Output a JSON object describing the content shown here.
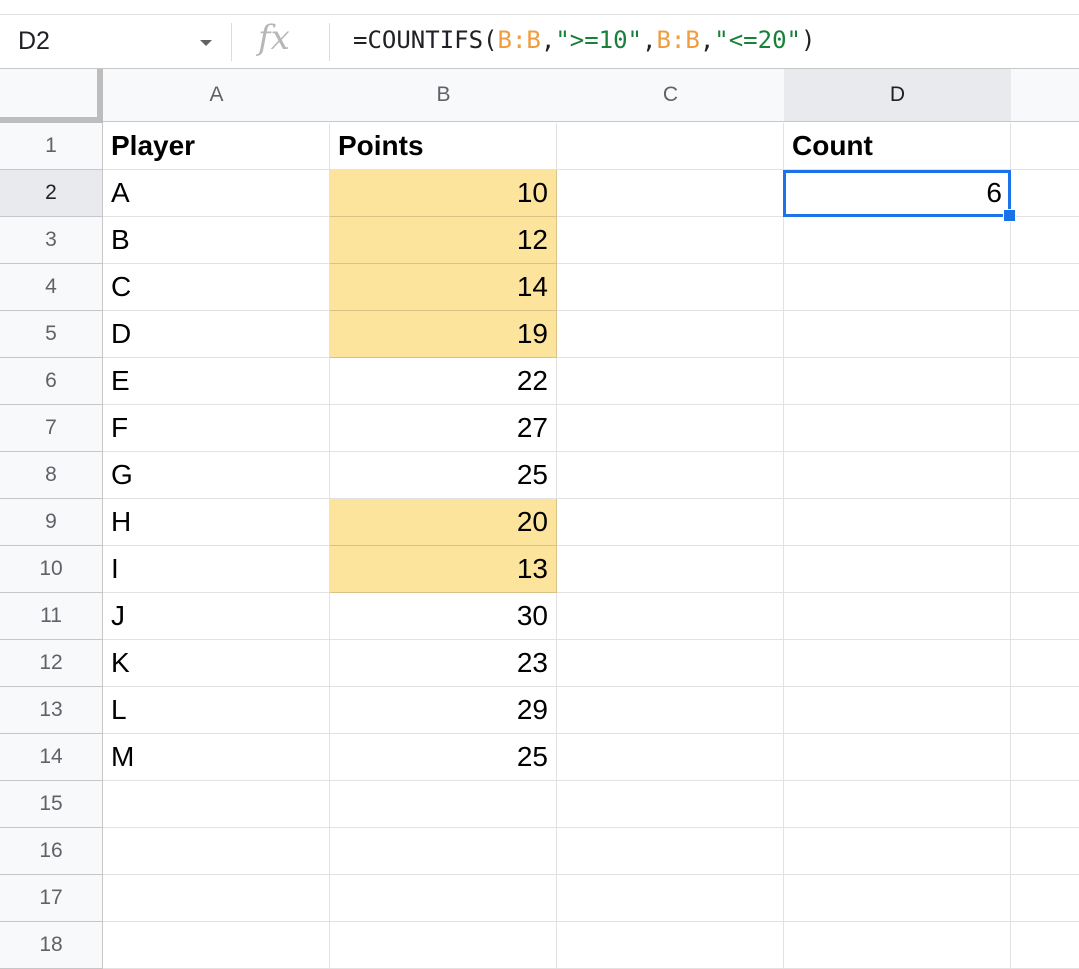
{
  "name_box": "D2",
  "fx_label": "fx",
  "formula": {
    "parts": [
      {
        "text": "=COUNTIFS(",
        "kind": "plain"
      },
      {
        "text": "B:B",
        "kind": "range"
      },
      {
        "text": ",",
        "kind": "plain"
      },
      {
        "text": "\">=10\"",
        "kind": "string"
      },
      {
        "text": ",",
        "kind": "plain"
      },
      {
        "text": "B:B",
        "kind": "range"
      },
      {
        "text": ",",
        "kind": "plain"
      },
      {
        "text": "\"<=20\"",
        "kind": "string"
      },
      {
        "text": ")",
        "kind": "plain"
      }
    ]
  },
  "columns": [
    "A",
    "B",
    "C",
    "D"
  ],
  "selected_column": "D",
  "selected_row": "2",
  "rows": [
    {
      "n": "1",
      "A": "Player",
      "B": "Points",
      "C": "",
      "D": "Count",
      "header": true
    },
    {
      "n": "2",
      "A": "A",
      "B": "10",
      "C": "",
      "D": "6",
      "hl": true
    },
    {
      "n": "3",
      "A": "B",
      "B": "12",
      "C": "",
      "D": "",
      "hl": true
    },
    {
      "n": "4",
      "A": "C",
      "B": "14",
      "C": "",
      "D": "",
      "hl": true
    },
    {
      "n": "5",
      "A": "D",
      "B": "19",
      "C": "",
      "D": "",
      "hl": true
    },
    {
      "n": "6",
      "A": "E",
      "B": "22",
      "C": "",
      "D": ""
    },
    {
      "n": "7",
      "A": "F",
      "B": "27",
      "C": "",
      "D": ""
    },
    {
      "n": "8",
      "A": "G",
      "B": "25",
      "C": "",
      "D": ""
    },
    {
      "n": "9",
      "A": "H",
      "B": "20",
      "C": "",
      "D": "",
      "hl": true
    },
    {
      "n": "10",
      "A": "I",
      "B": "13",
      "C": "",
      "D": "",
      "hl": true
    },
    {
      "n": "11",
      "A": "J",
      "B": "30",
      "C": "",
      "D": ""
    },
    {
      "n": "12",
      "A": "K",
      "B": "23",
      "C": "",
      "D": ""
    },
    {
      "n": "13",
      "A": "L",
      "B": "29",
      "C": "",
      "D": ""
    },
    {
      "n": "14",
      "A": "M",
      "B": "25",
      "C": "",
      "D": ""
    },
    {
      "n": "15",
      "A": "",
      "B": "",
      "C": "",
      "D": ""
    },
    {
      "n": "16",
      "A": "",
      "B": "",
      "C": "",
      "D": ""
    },
    {
      "n": "17",
      "A": "",
      "B": "",
      "C": "",
      "D": ""
    },
    {
      "n": "18",
      "A": "",
      "B": "",
      "C": "",
      "D": ""
    }
  ],
  "colors": {
    "highlight": "#fde49c",
    "selection": "#1a73e8",
    "range_ref": "#f09d3f",
    "string_literal": "#188038"
  }
}
